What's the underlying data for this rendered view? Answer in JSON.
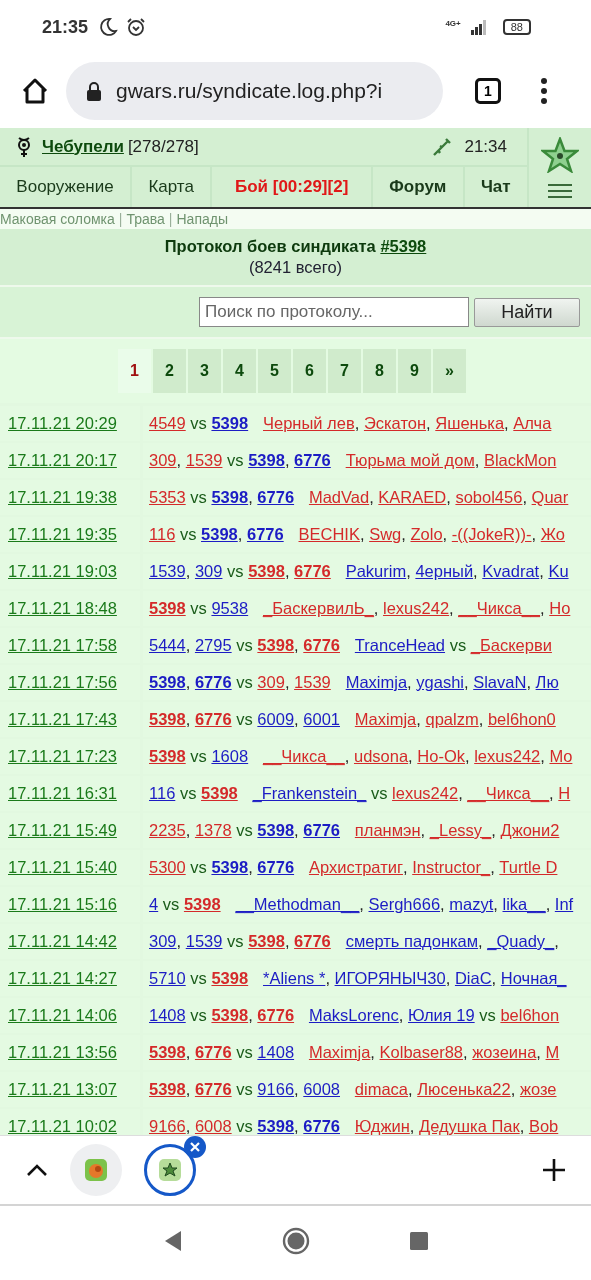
{
  "status_bar": {
    "time": "21:35",
    "network": "4G+",
    "battery": "88"
  },
  "browser": {
    "url": "gwars.ru/syndicate.log.php?i",
    "tab_count": "1"
  },
  "header": {
    "player": "Чебупели",
    "hp": "[278/278]",
    "time": "21:34"
  },
  "nav": [
    {
      "label": "Вооружение",
      "kind": "plain"
    },
    {
      "label": "Карта",
      "kind": "plain"
    },
    {
      "label": "Бой [00:29][2]",
      "kind": "alert"
    },
    {
      "label": "Форум",
      "kind": "bold"
    },
    {
      "label": "Чат",
      "kind": "bold"
    }
  ],
  "sublinks": [
    {
      "kind": "link",
      "text": "Маковая соломка"
    },
    {
      "kind": "sep",
      "text": "|"
    },
    {
      "kind": "link",
      "text": "Трава"
    },
    {
      "kind": "sep",
      "text": "|"
    },
    {
      "kind": "link",
      "text": "Напады"
    }
  ],
  "title": {
    "text": "Протокол боев синдиката ",
    "link": "#5398",
    "total": "(8241 всего)"
  },
  "search": {
    "placeholder": "Поиск по протоколу...",
    "button": "Найти"
  },
  "pages": [
    {
      "label": "1",
      "selected": true
    },
    {
      "label": "2",
      "selected": false
    },
    {
      "label": "3",
      "selected": false
    },
    {
      "label": "4",
      "selected": false
    },
    {
      "label": "5",
      "selected": false
    },
    {
      "label": "6",
      "selected": false
    },
    {
      "label": "7",
      "selected": false
    },
    {
      "label": "8",
      "selected": false
    },
    {
      "label": "9",
      "selected": false
    },
    {
      "label": "»",
      "selected": false
    }
  ],
  "rows": [
    {
      "date": "17.11.21 20:29",
      "parts": [
        {
          "kind": "clan",
          "text": "4549",
          "color": "#d42a2a"
        },
        {
          "kind": "vs",
          "text": "vs"
        },
        {
          "kind": "clan",
          "text": "5398",
          "color": "#1c1cc4",
          "bold": true
        },
        {
          "kind": "gap"
        },
        {
          "kind": "player",
          "text": "Черный лев",
          "color": "#d42a2a"
        },
        {
          "kind": "comma",
          "text": ","
        },
        {
          "kind": "player",
          "text": "Эскатон",
          "color": "#d42a2a"
        },
        {
          "kind": "comma",
          "text": ","
        },
        {
          "kind": "player",
          "text": "Яшенька",
          "color": "#d42a2a"
        },
        {
          "kind": "comma",
          "text": ","
        },
        {
          "kind": "player",
          "text": "Алча",
          "color": "#d42a2a"
        }
      ]
    },
    {
      "date": "17.11.21 20:17",
      "parts": [
        {
          "kind": "clan",
          "text": "309",
          "color": "#d42a2a"
        },
        {
          "kind": "comma",
          "text": ","
        },
        {
          "kind": "clan",
          "text": "1539",
          "color": "#d42a2a"
        },
        {
          "kind": "vs",
          "text": "vs"
        },
        {
          "kind": "clan",
          "text": "5398",
          "color": "#1c1cc4",
          "bold": true
        },
        {
          "kind": "comma",
          "text": ","
        },
        {
          "kind": "clan",
          "text": "6776",
          "color": "#1c1cc4",
          "bold": true
        },
        {
          "kind": "gap"
        },
        {
          "kind": "player",
          "text": "Тюрьма мой дом",
          "color": "#d42a2a"
        },
        {
          "kind": "comma",
          "text": ","
        },
        {
          "kind": "player",
          "text": "BlackMon",
          "color": "#d42a2a"
        }
      ]
    },
    {
      "date": "17.11.21 19:38",
      "parts": [
        {
          "kind": "clan",
          "text": "5353",
          "color": "#d42a2a"
        },
        {
          "kind": "vs",
          "text": "vs"
        },
        {
          "kind": "clan",
          "text": "5398",
          "color": "#1c1cc4",
          "bold": true
        },
        {
          "kind": "comma",
          "text": ","
        },
        {
          "kind": "clan",
          "text": "6776",
          "color": "#1c1cc4",
          "bold": true
        },
        {
          "kind": "gap"
        },
        {
          "kind": "player",
          "text": "MadVad",
          "color": "#d42a2a"
        },
        {
          "kind": "comma",
          "text": ","
        },
        {
          "kind": "player",
          "text": "KARAED",
          "color": "#d42a2a"
        },
        {
          "kind": "comma",
          "text": ","
        },
        {
          "kind": "player",
          "text": "sobol456",
          "color": "#d42a2a"
        },
        {
          "kind": "comma",
          "text": ","
        },
        {
          "kind": "player",
          "text": "Quar",
          "color": "#d42a2a"
        }
      ]
    },
    {
      "date": "17.11.21 19:35",
      "parts": [
        {
          "kind": "clan",
          "text": "116",
          "color": "#d42a2a"
        },
        {
          "kind": "vs",
          "text": "vs"
        },
        {
          "kind": "clan",
          "text": "5398",
          "color": "#1c1cc4",
          "bold": true
        },
        {
          "kind": "comma",
          "text": ","
        },
        {
          "kind": "clan",
          "text": "6776",
          "color": "#1c1cc4",
          "bold": true
        },
        {
          "kind": "gap"
        },
        {
          "kind": "player",
          "text": "BECHIK",
          "color": "#d42a2a"
        },
        {
          "kind": "comma",
          "text": ","
        },
        {
          "kind": "player",
          "text": "Swg",
          "color": "#d42a2a"
        },
        {
          "kind": "comma",
          "text": ","
        },
        {
          "kind": "player",
          "text": "Zolo",
          "color": "#d42a2a"
        },
        {
          "kind": "comma",
          "text": ","
        },
        {
          "kind": "player",
          "text": "-((JokeR))-",
          "color": "#d42a2a"
        },
        {
          "kind": "comma",
          "text": ","
        },
        {
          "kind": "player",
          "text": "Жо",
          "color": "#d42a2a"
        }
      ]
    },
    {
      "date": "17.11.21 19:03",
      "parts": [
        {
          "kind": "clan",
          "text": "1539",
          "color": "#1c1cc4"
        },
        {
          "kind": "comma",
          "text": ","
        },
        {
          "kind": "clan",
          "text": "309",
          "color": "#1c1cc4"
        },
        {
          "kind": "vs",
          "text": "vs"
        },
        {
          "kind": "clan",
          "text": "5398",
          "color": "#d42a2a",
          "bold": true
        },
        {
          "kind": "comma",
          "text": ","
        },
        {
          "kind": "clan",
          "text": "6776",
          "color": "#d42a2a",
          "bold": true
        },
        {
          "kind": "gap"
        },
        {
          "kind": "player",
          "text": "Pakurim",
          "color": "#1c1cc4"
        },
        {
          "kind": "comma",
          "text": ","
        },
        {
          "kind": "player",
          "text": "4ерный",
          "color": "#1c1cc4"
        },
        {
          "kind": "comma",
          "text": ","
        },
        {
          "kind": "player",
          "text": "Kvadrat",
          "color": "#1c1cc4"
        },
        {
          "kind": "comma",
          "text": ","
        },
        {
          "kind": "player",
          "text": "Ku",
          "color": "#1c1cc4"
        }
      ]
    },
    {
      "date": "17.11.21 18:48",
      "parts": [
        {
          "kind": "clan",
          "text": "5398",
          "color": "#d42a2a",
          "bold": true
        },
        {
          "kind": "vs",
          "text": "vs"
        },
        {
          "kind": "clan",
          "text": "9538",
          "color": "#1c1cc4"
        },
        {
          "kind": "gap"
        },
        {
          "kind": "player",
          "text": "_БаскервилЬ_",
          "color": "#d42a2a"
        },
        {
          "kind": "comma",
          "text": ","
        },
        {
          "kind": "player",
          "text": "lexus242",
          "color": "#d42a2a"
        },
        {
          "kind": "comma",
          "text": ","
        },
        {
          "kind": "player",
          "text": "__Чикса__",
          "color": "#d42a2a"
        },
        {
          "kind": "comma",
          "text": ","
        },
        {
          "kind": "player",
          "text": "Но",
          "color": "#d42a2a"
        }
      ]
    },
    {
      "date": "17.11.21 17:58",
      "parts": [
        {
          "kind": "clan",
          "text": "5444",
          "color": "#1c1cc4"
        },
        {
          "kind": "comma",
          "text": ","
        },
        {
          "kind": "clan",
          "text": "2795",
          "color": "#1c1cc4"
        },
        {
          "kind": "vs",
          "text": "vs"
        },
        {
          "kind": "clan",
          "text": "5398",
          "color": "#d42a2a",
          "bold": true
        },
        {
          "kind": "comma",
          "text": ","
        },
        {
          "kind": "clan",
          "text": "6776",
          "color": "#d42a2a",
          "bold": true
        },
        {
          "kind": "gap"
        },
        {
          "kind": "player",
          "text": "TranceHead",
          "color": "#1c1cc4"
        },
        {
          "kind": "vs",
          "text": "vs"
        },
        {
          "kind": "player",
          "text": "_Баскерви",
          "color": "#d42a2a"
        }
      ]
    },
    {
      "date": "17.11.21 17:56",
      "parts": [
        {
          "kind": "clan",
          "text": "5398",
          "color": "#1c1cc4",
          "bold": true
        },
        {
          "kind": "comma",
          "text": ","
        },
        {
          "kind": "clan",
          "text": "6776",
          "color": "#1c1cc4",
          "bold": true
        },
        {
          "kind": "vs",
          "text": "vs"
        },
        {
          "kind": "clan",
          "text": "309",
          "color": "#d42a2a"
        },
        {
          "kind": "comma",
          "text": ","
        },
        {
          "kind": "clan",
          "text": "1539",
          "color": "#d42a2a"
        },
        {
          "kind": "gap"
        },
        {
          "kind": "player",
          "text": "Maximja",
          "color": "#1c1cc4"
        },
        {
          "kind": "comma",
          "text": ","
        },
        {
          "kind": "player",
          "text": "ygashi",
          "color": "#1c1cc4"
        },
        {
          "kind": "comma",
          "text": ","
        },
        {
          "kind": "player",
          "text": "SlavaN",
          "color": "#1c1cc4"
        },
        {
          "kind": "comma",
          "text": ","
        },
        {
          "kind": "player",
          "text": "Лю",
          "color": "#1c1cc4"
        }
      ]
    },
    {
      "date": "17.11.21 17:43",
      "parts": [
        {
          "kind": "clan",
          "text": "5398",
          "color": "#d42a2a",
          "bold": true
        },
        {
          "kind": "comma",
          "text": ","
        },
        {
          "kind": "clan",
          "text": "6776",
          "color": "#d42a2a",
          "bold": true
        },
        {
          "kind": "vs",
          "text": "vs"
        },
        {
          "kind": "clan",
          "text": "6009",
          "color": "#1c1cc4"
        },
        {
          "kind": "comma",
          "text": ","
        },
        {
          "kind": "clan",
          "text": "6001",
          "color": "#1c1cc4"
        },
        {
          "kind": "gap"
        },
        {
          "kind": "player",
          "text": "Maximja",
          "color": "#d42a2a"
        },
        {
          "kind": "comma",
          "text": ","
        },
        {
          "kind": "player",
          "text": "qpalzm",
          "color": "#d42a2a"
        },
        {
          "kind": "comma",
          "text": ","
        },
        {
          "kind": "player",
          "text": "bel6hon0",
          "color": "#d42a2a"
        }
      ]
    },
    {
      "date": "17.11.21 17:23",
      "parts": [
        {
          "kind": "clan",
          "text": "5398",
          "color": "#d42a2a",
          "bold": true
        },
        {
          "kind": "vs",
          "text": "vs"
        },
        {
          "kind": "clan",
          "text": "1608",
          "color": "#1c1cc4"
        },
        {
          "kind": "gap"
        },
        {
          "kind": "player",
          "text": "__Чикса__",
          "color": "#d42a2a"
        },
        {
          "kind": "comma",
          "text": ","
        },
        {
          "kind": "player",
          "text": "udsona",
          "color": "#d42a2a"
        },
        {
          "kind": "comma",
          "text": ","
        },
        {
          "kind": "player",
          "text": "Ho-Ok",
          "color": "#d42a2a"
        },
        {
          "kind": "comma",
          "text": ","
        },
        {
          "kind": "player",
          "text": "lexus242",
          "color": "#d42a2a"
        },
        {
          "kind": "comma",
          "text": ","
        },
        {
          "kind": "player",
          "text": "Mo",
          "color": "#d42a2a"
        }
      ]
    },
    {
      "date": "17.11.21 16:31",
      "parts": [
        {
          "kind": "clan",
          "text": "116",
          "color": "#1c1cc4"
        },
        {
          "kind": "vs",
          "text": "vs"
        },
        {
          "kind": "clan",
          "text": "5398",
          "color": "#d42a2a",
          "bold": true
        },
        {
          "kind": "gap"
        },
        {
          "kind": "player",
          "text": "_Frankenstein_",
          "color": "#1c1cc4"
        },
        {
          "kind": "vs",
          "text": "vs"
        },
        {
          "kind": "player",
          "text": "lexus242",
          "color": "#d42a2a"
        },
        {
          "kind": "comma",
          "text": ","
        },
        {
          "kind": "player",
          "text": "__Чикса__",
          "color": "#d42a2a"
        },
        {
          "kind": "comma",
          "text": ","
        },
        {
          "kind": "player",
          "text": "Н",
          "color": "#d42a2a"
        }
      ]
    },
    {
      "date": "17.11.21 15:49",
      "parts": [
        {
          "kind": "clan",
          "text": "2235",
          "color": "#d42a2a"
        },
        {
          "kind": "comma",
          "text": ","
        },
        {
          "kind": "clan",
          "text": "1378",
          "color": "#d42a2a"
        },
        {
          "kind": "vs",
          "text": "vs"
        },
        {
          "kind": "clan",
          "text": "5398",
          "color": "#1c1cc4",
          "bold": true
        },
        {
          "kind": "comma",
          "text": ","
        },
        {
          "kind": "clan",
          "text": "6776",
          "color": "#1c1cc4",
          "bold": true
        },
        {
          "kind": "gap"
        },
        {
          "kind": "player",
          "text": "планмэн",
          "color": "#d42a2a"
        },
        {
          "kind": "comma",
          "text": ","
        },
        {
          "kind": "player",
          "text": "_Lessy_",
          "color": "#d42a2a"
        },
        {
          "kind": "comma",
          "text": ","
        },
        {
          "kind": "player",
          "text": "Джони2",
          "color": "#d42a2a"
        }
      ]
    },
    {
      "date": "17.11.21 15:40",
      "parts": [
        {
          "kind": "clan",
          "text": "5300",
          "color": "#d42a2a"
        },
        {
          "kind": "vs",
          "text": "vs"
        },
        {
          "kind": "clan",
          "text": "5398",
          "color": "#1c1cc4",
          "bold": true
        },
        {
          "kind": "comma",
          "text": ","
        },
        {
          "kind": "clan",
          "text": "6776",
          "color": "#1c1cc4",
          "bold": true
        },
        {
          "kind": "gap"
        },
        {
          "kind": "player",
          "text": "Архистратиг",
          "color": "#d42a2a"
        },
        {
          "kind": "comma",
          "text": ","
        },
        {
          "kind": "player",
          "text": "Instructor_",
          "color": "#d42a2a"
        },
        {
          "kind": "comma",
          "text": ","
        },
        {
          "kind": "player",
          "text": "Turtle D",
          "color": "#d42a2a"
        }
      ]
    },
    {
      "date": "17.11.21 15:16",
      "parts": [
        {
          "kind": "clan",
          "text": "4",
          "color": "#1c1cc4"
        },
        {
          "kind": "vs",
          "text": "vs"
        },
        {
          "kind": "clan",
          "text": "5398",
          "color": "#d42a2a",
          "bold": true
        },
        {
          "kind": "gap"
        },
        {
          "kind": "player",
          "text": "__Methodman__",
          "color": "#1c1cc4"
        },
        {
          "kind": "comma",
          "text": ","
        },
        {
          "kind": "player",
          "text": "Sergh666",
          "color": "#1c1cc4"
        },
        {
          "kind": "comma",
          "text": ","
        },
        {
          "kind": "player",
          "text": "mazyt",
          "color": "#1c1cc4"
        },
        {
          "kind": "comma",
          "text": ","
        },
        {
          "kind": "player",
          "text": "lika__",
          "color": "#1c1cc4"
        },
        {
          "kind": "comma",
          "text": ","
        },
        {
          "kind": "player",
          "text": "Inf",
          "color": "#1c1cc4"
        }
      ]
    },
    {
      "date": "17.11.21 14:42",
      "parts": [
        {
          "kind": "clan",
          "text": "309",
          "color": "#1c1cc4"
        },
        {
          "kind": "comma",
          "text": ","
        },
        {
          "kind": "clan",
          "text": "1539",
          "color": "#1c1cc4"
        },
        {
          "kind": "vs",
          "text": "vs"
        },
        {
          "kind": "clan",
          "text": "5398",
          "color": "#d42a2a",
          "bold": true
        },
        {
          "kind": "comma",
          "text": ","
        },
        {
          "kind": "clan",
          "text": "6776",
          "color": "#d42a2a",
          "bold": true
        },
        {
          "kind": "gap"
        },
        {
          "kind": "player",
          "text": "смерть падонкам",
          "color": "#1c1cc4"
        },
        {
          "kind": "comma",
          "text": ","
        },
        {
          "kind": "player",
          "text": "_Quady_",
          "color": "#1c1cc4"
        },
        {
          "kind": "comma",
          "text": ","
        }
      ]
    },
    {
      "date": "17.11.21 14:27",
      "parts": [
        {
          "kind": "clan",
          "text": "5710",
          "color": "#1c1cc4"
        },
        {
          "kind": "vs",
          "text": "vs"
        },
        {
          "kind": "clan",
          "text": "5398",
          "color": "#d42a2a",
          "bold": true
        },
        {
          "kind": "gap"
        },
        {
          "kind": "player",
          "text": "*Aliens *",
          "color": "#1c1cc4"
        },
        {
          "kind": "comma",
          "text": ","
        },
        {
          "kind": "player",
          "text": "ИГОРЯНЫЧ30",
          "color": "#1c1cc4"
        },
        {
          "kind": "comma",
          "text": ","
        },
        {
          "kind": "player",
          "text": "DiaC",
          "color": "#1c1cc4"
        },
        {
          "kind": "comma",
          "text": ","
        },
        {
          "kind": "player",
          "text": "Ночная_",
          "color": "#1c1cc4"
        }
      ]
    },
    {
      "date": "17.11.21 14:06",
      "parts": [
        {
          "kind": "clan",
          "text": "1408",
          "color": "#1c1cc4"
        },
        {
          "kind": "vs",
          "text": "vs"
        },
        {
          "kind": "clan",
          "text": "5398",
          "color": "#d42a2a",
          "bold": true
        },
        {
          "kind": "comma",
          "text": ","
        },
        {
          "kind": "clan",
          "text": "6776",
          "color": "#d42a2a",
          "bold": true
        },
        {
          "kind": "gap"
        },
        {
          "kind": "player",
          "text": "MaksLorenc",
          "color": "#1c1cc4"
        },
        {
          "kind": "comma",
          "text": ","
        },
        {
          "kind": "player",
          "text": "Юлия 19",
          "color": "#1c1cc4"
        },
        {
          "kind": "vs",
          "text": "vs"
        },
        {
          "kind": "player",
          "text": "bel6hon",
          "color": "#d42a2a"
        }
      ]
    },
    {
      "date": "17.11.21 13:56",
      "parts": [
        {
          "kind": "clan",
          "text": "5398",
          "color": "#d42a2a",
          "bold": true
        },
        {
          "kind": "comma",
          "text": ","
        },
        {
          "kind": "clan",
          "text": "6776",
          "color": "#d42a2a",
          "bold": true
        },
        {
          "kind": "vs",
          "text": "vs"
        },
        {
          "kind": "clan",
          "text": "1408",
          "color": "#1c1cc4"
        },
        {
          "kind": "gap"
        },
        {
          "kind": "player",
          "text": "Maximja",
          "color": "#d42a2a"
        },
        {
          "kind": "comma",
          "text": ","
        },
        {
          "kind": "player",
          "text": "Kolbaser88",
          "color": "#d42a2a"
        },
        {
          "kind": "comma",
          "text": ","
        },
        {
          "kind": "player",
          "text": "жозеина",
          "color": "#d42a2a"
        },
        {
          "kind": "comma",
          "text": ","
        },
        {
          "kind": "player",
          "text": "M",
          "color": "#d42a2a"
        }
      ]
    },
    {
      "date": "17.11.21 13:07",
      "parts": [
        {
          "kind": "clan",
          "text": "5398",
          "color": "#d42a2a",
          "bold": true
        },
        {
          "kind": "comma",
          "text": ","
        },
        {
          "kind": "clan",
          "text": "6776",
          "color": "#d42a2a",
          "bold": true
        },
        {
          "kind": "vs",
          "text": "vs"
        },
        {
          "kind": "clan",
          "text": "9166",
          "color": "#1c1cc4"
        },
        {
          "kind": "comma",
          "text": ","
        },
        {
          "kind": "clan",
          "text": "6008",
          "color": "#1c1cc4"
        },
        {
          "kind": "gap"
        },
        {
          "kind": "player",
          "text": "dimaca",
          "color": "#d42a2a"
        },
        {
          "kind": "comma",
          "text": ","
        },
        {
          "kind": "player",
          "text": "Люсенька22",
          "color": "#d42a2a"
        },
        {
          "kind": "comma",
          "text": ","
        },
        {
          "kind": "player",
          "text": "жозе",
          "color": "#d42a2a"
        }
      ]
    },
    {
      "date": "17.11.21 10:02",
      "parts": [
        {
          "kind": "clan",
          "text": "9166",
          "color": "#d42a2a"
        },
        {
          "kind": "comma",
          "text": ","
        },
        {
          "kind": "clan",
          "text": "6008",
          "color": "#d42a2a"
        },
        {
          "kind": "vs",
          "text": "vs"
        },
        {
          "kind": "clan",
          "text": "5398",
          "color": "#1c1cc4",
          "bold": true
        },
        {
          "kind": "comma",
          "text": ","
        },
        {
          "kind": "clan",
          "text": "6776",
          "color": "#1c1cc4",
          "bold": true
        },
        {
          "kind": "gap"
        },
        {
          "kind": "player",
          "text": "Юджин",
          "color": "#d42a2a"
        },
        {
          "kind": "comma",
          "text": ","
        },
        {
          "kind": "player",
          "text": "Дедушка Пак",
          "color": "#d42a2a"
        },
        {
          "kind": "comma",
          "text": ","
        },
        {
          "kind": "player",
          "text": "Bob",
          "color": "#d42a2a"
        }
      ]
    }
  ],
  "tab_strip": {
    "tabs": [
      {
        "selected": false
      },
      {
        "selected": true
      }
    ]
  }
}
